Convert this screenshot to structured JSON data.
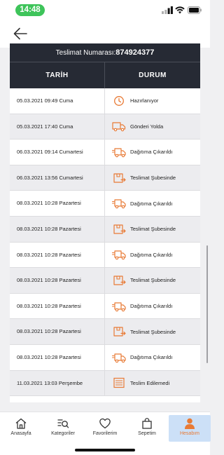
{
  "status_bar": {
    "time": "14:48"
  },
  "tracking": {
    "label": "Teslimat Numarası:",
    "number": "874924377"
  },
  "table": {
    "headers": {
      "date": "TARİH",
      "status": "DURUM"
    },
    "rows": [
      {
        "date": "05.03.2021 09:49 Cuma",
        "status": "Hazırlanıyor",
        "icon": "clock-icon"
      },
      {
        "date": "05.03.2021 17:40 Cuma",
        "status": "Gönderi Yolda",
        "icon": "truck-icon"
      },
      {
        "date": "06.03.2021 09:14 Cumartesi",
        "status": "Dağıtıma Çıkarıldı",
        "icon": "delivery-truck-icon"
      },
      {
        "date": "06.03.2021 13:56 Cumartesi",
        "status": "Teslimat Şubesinde",
        "icon": "branch-box-icon"
      },
      {
        "date": "08.03.2021 10:28 Pazartesi",
        "status": "Dağıtıma Çıkarıldı",
        "icon": "delivery-truck-icon"
      },
      {
        "date": "08.03.2021 10:28 Pazartesi",
        "status": "Teslimat Şubesinde",
        "icon": "branch-box-icon"
      },
      {
        "date": "08.03.2021 10:28 Pazartesi",
        "status": "Dağıtıma Çıkarıldı",
        "icon": "delivery-truck-icon"
      },
      {
        "date": "08.03.2021 10:28 Pazartesi",
        "status": "Teslimat Şubesinde",
        "icon": "branch-box-icon"
      },
      {
        "date": "08.03.2021 10:28 Pazartesi",
        "status": "Dağıtıma Çıkarıldı",
        "icon": "delivery-truck-icon"
      },
      {
        "date": "08.03.2021 10:28 Pazartesi",
        "status": "Teslimat Şubesinde",
        "icon": "branch-box-icon"
      },
      {
        "date": "08.03.2021 10:28 Pazartesi",
        "status": "Dağıtıma Çıkarıldı",
        "icon": "delivery-truck-icon"
      },
      {
        "date": "11.03.2021 13:03 Perşembe",
        "status": "Teslim Edilemedi",
        "icon": "failed-delivery-icon"
      }
    ]
  },
  "tabs": [
    {
      "label": "Anasayfa",
      "icon": "home-icon"
    },
    {
      "label": "Kategoriler",
      "icon": "categories-search-icon"
    },
    {
      "label": "Favorilerim",
      "icon": "heart-icon"
    },
    {
      "label": "Sepetim",
      "icon": "bag-icon"
    },
    {
      "label": "Hesabım",
      "icon": "user-icon",
      "active": true
    }
  ],
  "colors": {
    "accent": "#e87a35",
    "table_header_bg": "#262a34",
    "active_tab_bg": "#cce0f7"
  }
}
